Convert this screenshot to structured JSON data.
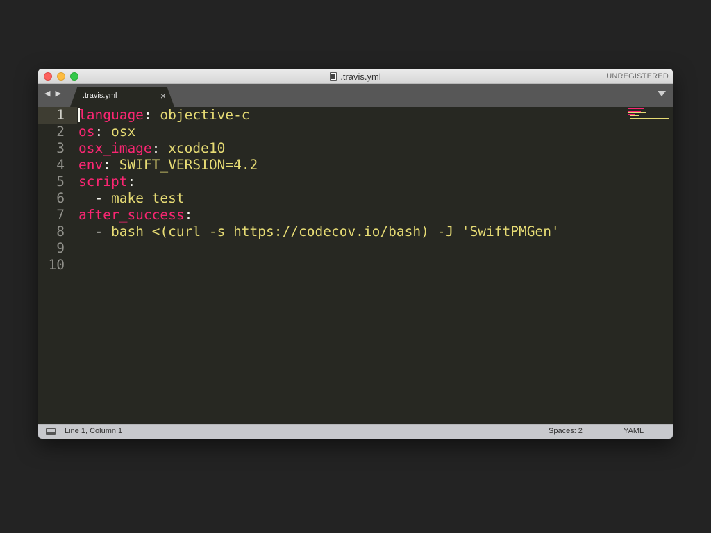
{
  "window": {
    "title": ".travis.yml",
    "registration": "UNREGISTERED"
  },
  "tabs": {
    "nav_icon": "back-forward-arrows",
    "nav_glyph": "◀ ▶",
    "items": [
      {
        "label": ".travis.yml",
        "close_glyph": "×"
      }
    ],
    "dropdown_icon": "triangle-down"
  },
  "editor": {
    "cursor_line": 1,
    "lines": [
      {
        "num": "1",
        "key": "language",
        "sep": ": ",
        "val": "objective-c"
      },
      {
        "num": "2",
        "key": "os",
        "sep": ": ",
        "val": "osx"
      },
      {
        "num": "3",
        "key": "osx_image",
        "sep": ": ",
        "val": "xcode10"
      },
      {
        "num": "4",
        "key": "env",
        "sep": ": ",
        "val": "SWIFT_VERSION=4.2"
      },
      {
        "num": "5",
        "key": "script",
        "sep": ":",
        "val": ""
      },
      {
        "num": "6",
        "key": "",
        "sep": "  - ",
        "val": "make test"
      },
      {
        "num": "7",
        "key": "after_success",
        "sep": ":",
        "val": ""
      },
      {
        "num": "8",
        "key": "",
        "sep": "  - ",
        "val": "bash <(curl -s https://codecov.io/bash) -J 'SwiftPMGen'"
      },
      {
        "num": "9",
        "key": "",
        "sep": "",
        "val": ""
      },
      {
        "num": "10",
        "key": "",
        "sep": "",
        "val": ""
      }
    ]
  },
  "status": {
    "position": "Line 1, Column 1",
    "indentation": "Spaces: 2",
    "syntax": "YAML"
  },
  "colors": {
    "background": "#272822",
    "key": "#f92672",
    "value": "#e6db74",
    "punctuation": "#f8f8f2"
  }
}
